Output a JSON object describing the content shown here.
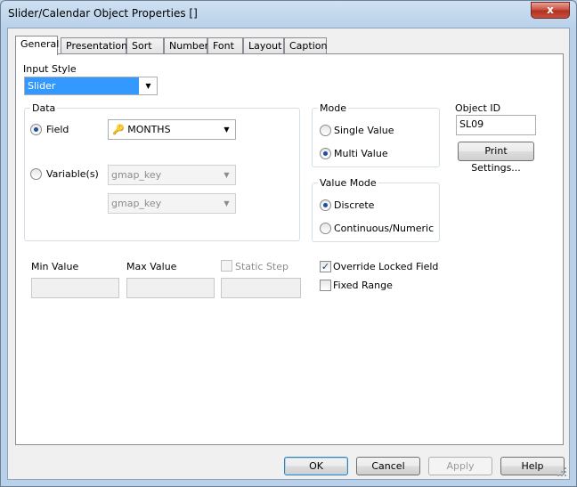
{
  "window": {
    "title": "Slider/Calendar Object Properties []",
    "close_glyph": "x"
  },
  "tabs": [
    {
      "label": "General",
      "active": true
    },
    {
      "label": "Presentation",
      "active": false
    },
    {
      "label": "Sort",
      "active": false
    },
    {
      "label": "Number",
      "active": false
    },
    {
      "label": "Font",
      "active": false
    },
    {
      "label": "Layout",
      "active": false
    },
    {
      "label": "Caption",
      "active": false
    }
  ],
  "input_style": {
    "label": "Input Style",
    "value": "Slider"
  },
  "data_group": {
    "title": "Data",
    "field_label": "Field",
    "field_value": "MONTHS",
    "field_selected": true,
    "variables_label": "Variable(s)",
    "variable1": "gmap_key",
    "variable2": "gmap_key"
  },
  "mode_group": {
    "title": "Mode",
    "options": [
      {
        "label": "Single Value",
        "selected": false
      },
      {
        "label": "Multi Value",
        "selected": true
      }
    ]
  },
  "value_mode_group": {
    "title": "Value Mode",
    "options": [
      {
        "label": "Discrete",
        "selected": true
      },
      {
        "label": "Continuous/Numeric",
        "selected": false
      }
    ]
  },
  "object_id": {
    "label": "Object ID",
    "value": "SL09"
  },
  "print_settings_label": "Print Settings...",
  "range": {
    "min_label": "Min Value",
    "max_label": "Max Value",
    "static_step_label": "Static Step",
    "min_value": "",
    "max_value": "",
    "step_value": ""
  },
  "override_locked_field": {
    "label": "Override Locked Field",
    "checked": true
  },
  "fixed_range": {
    "label": "Fixed Range",
    "checked": false
  },
  "buttons": {
    "ok": "OK",
    "cancel": "Cancel",
    "apply": "Apply",
    "help": "Help"
  },
  "icons": {
    "field_icon": "key-icon",
    "dropdown": "chevron-down-icon"
  },
  "colors": {
    "selection": "#3399ff",
    "title_bar": "#b9d1ea"
  }
}
